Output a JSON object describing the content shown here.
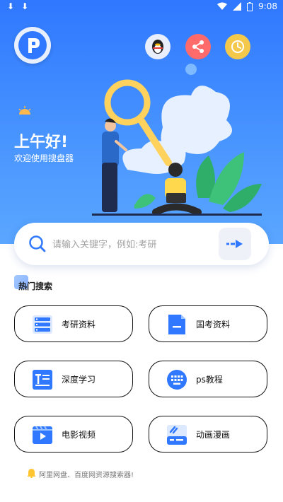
{
  "status": {
    "time": "9:08"
  },
  "hero": {
    "greeting": "上午好!",
    "welcome": "欢迎使用搜盘器"
  },
  "search": {
    "placeholder": "请输入关键字，例如:考研"
  },
  "section": {
    "title": "热门搜索"
  },
  "categories": [
    {
      "label": "考研资料",
      "icon": "list-icon"
    },
    {
      "label": "国考资料",
      "icon": "document-icon"
    },
    {
      "label": "深度学习",
      "icon": "text-doc-icon"
    },
    {
      "label": "ps教程",
      "icon": "keyboard-icon"
    },
    {
      "label": "电影视频",
      "icon": "video-icon"
    },
    {
      "label": "动画漫画",
      "icon": "brush-icon"
    }
  ],
  "footer": {
    "note": "阿里网盘、百度网资源搜索器!"
  },
  "colors": {
    "brand": "#2f78ff",
    "accent": "#ffcc4d"
  }
}
